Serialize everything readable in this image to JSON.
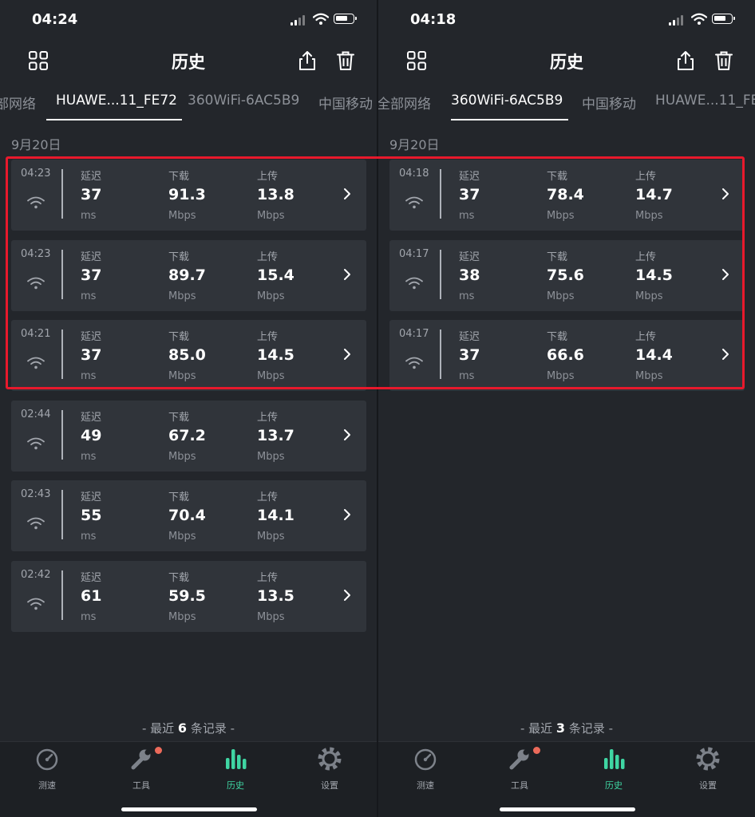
{
  "screens": [
    {
      "status_time": "04:24",
      "title": "历史",
      "tabs": [
        "部网络",
        "HUAWE...11_FE72",
        "360WiFi-6AC5B9",
        "中国移动"
      ],
      "active_tab": 1,
      "date": "9月20日",
      "records": [
        {
          "time": "04:23",
          "latency": "37",
          "download": "91.3",
          "upload": "13.8"
        },
        {
          "time": "04:23",
          "latency": "37",
          "download": "89.7",
          "upload": "15.4"
        },
        {
          "time": "04:21",
          "latency": "37",
          "download": "85.0",
          "upload": "14.5"
        },
        {
          "time": "02:44",
          "latency": "49",
          "download": "67.2",
          "upload": "13.7"
        },
        {
          "time": "02:43",
          "latency": "55",
          "download": "70.4",
          "upload": "14.1"
        },
        {
          "time": "02:42",
          "latency": "61",
          "download": "59.5",
          "upload": "13.5"
        }
      ],
      "summary": {
        "prefix": "- 最近",
        "count": "6",
        "suffix": "条记录 -"
      }
    },
    {
      "status_time": "04:18",
      "title": "历史",
      "tabs": [
        "全部网络",
        "360WiFi-6AC5B9",
        "中国移动",
        "HUAWE...11_FE"
      ],
      "active_tab": 1,
      "date": "9月20日",
      "records": [
        {
          "time": "04:18",
          "latency": "37",
          "download": "78.4",
          "upload": "14.7"
        },
        {
          "time": "04:17",
          "latency": "38",
          "download": "75.6",
          "upload": "14.5"
        },
        {
          "time": "04:17",
          "latency": "37",
          "download": "66.6",
          "upload": "14.4"
        }
      ],
      "summary": {
        "prefix": "- 最近",
        "count": "3",
        "suffix": "条记录 -"
      }
    }
  ],
  "labels": {
    "latency": "延迟",
    "download": "下载",
    "upload": "上传",
    "latency_unit": "ms",
    "speed_unit": "Mbps"
  },
  "nav": [
    {
      "label": "测速",
      "icon": "speedometer-icon"
    },
    {
      "label": "工具",
      "icon": "wrench-icon",
      "badge": true
    },
    {
      "label": "历史",
      "icon": "bar-chart-icon",
      "active": true
    },
    {
      "label": "设置",
      "icon": "gear-icon"
    }
  ],
  "colors": {
    "accent": "#3fd6a3",
    "highlight": "#e8192c",
    "badge": "#ec6a5a",
    "card": "#30343a",
    "background": "#23262b"
  }
}
